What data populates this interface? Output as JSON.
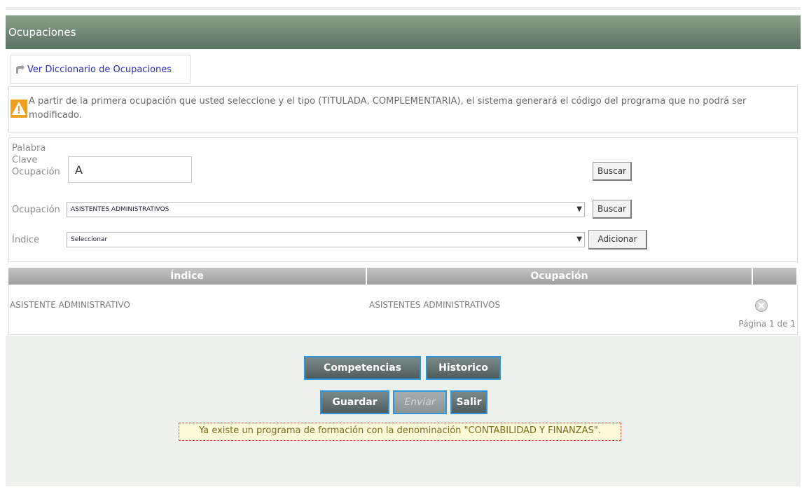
{
  "header": {
    "title": "Ocupaciones"
  },
  "dictionary_link": {
    "label": "Ver Diccionario de Ocupaciones",
    "icon": "arrow-link-icon"
  },
  "notice": {
    "icon": "warning-icon",
    "text": "A partir de la primera ocupación que usted seleccione y el tipo (TITULADA, COMPLEMENTARIA), el sistema generará el código del programa que no podrá ser modificado."
  },
  "form": {
    "keyword_label_1": "Palabra",
    "keyword_label_2": "Clave",
    "keyword_label_3": "Ocupación",
    "keyword_value": "A",
    "search_button_1": "Buscar",
    "occupation_label": "Ocupación",
    "occupation_selected": "ASISTENTES ADMINISTRATIVOS",
    "search_button_2": "Buscar",
    "index_label": "Índice",
    "index_selected": "Seleccionar",
    "add_button": "Adicionar"
  },
  "table": {
    "columns": [
      "Índice",
      "Ocupación",
      ""
    ],
    "rows": [
      {
        "indice": "ASISTENTE ADMINISTRATIVO",
        "ocupacion": "ASISTENTES ADMINISTRATIVOS",
        "action_icon": "delete-icon"
      }
    ],
    "pagination": "Página 1 de 1"
  },
  "actions": {
    "competencias": "Competencias",
    "historico": "Historico",
    "guardar": "Guardar",
    "enviar": "Enviar",
    "salir": "Salir"
  },
  "message": "Ya existe un programa de formación con la denominación \"CONTABILIDAD Y FINANZAS\".",
  "colors": {
    "header": "#5a7260",
    "button_border": "#2f95d6",
    "message_border": "#e04a3a",
    "link": "#2b2bbf"
  }
}
